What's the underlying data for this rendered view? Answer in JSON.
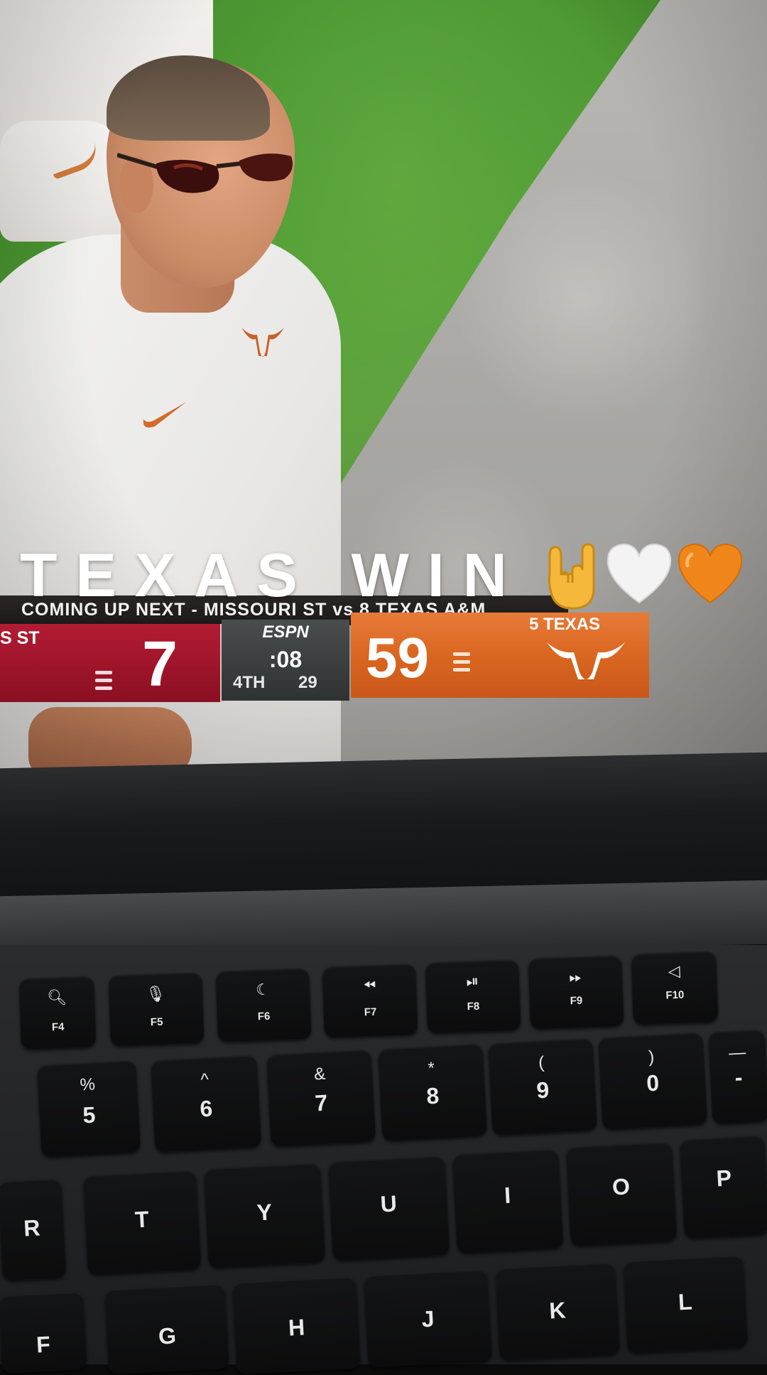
{
  "caption": {
    "text": "TEXAS WIN",
    "emojis": [
      "rock-on-hand",
      "white-heart",
      "orange-heart"
    ]
  },
  "scoreboard": {
    "ticker": "COMING UP NEXT - MISSOURI ST vs 8 TEXAS A&M",
    "network": "ESPN",
    "away": {
      "team": "S ST",
      "score": "7",
      "color": "#9c1428",
      "timeouts_remaining": 3
    },
    "home": {
      "team": "5 TEXAS",
      "score": "59",
      "color": "#d8651f",
      "timeouts_remaining": 3
    },
    "clock": ":08",
    "quarter": "4TH",
    "play_clock": "29"
  },
  "keyboard": {
    "function_row": [
      {
        "label": "F4",
        "icon": "search-icon"
      },
      {
        "label": "F5",
        "icon": "microphone-icon"
      },
      {
        "label": "F6",
        "icon": "moon-icon"
      },
      {
        "label": "F7",
        "icon": "rewind-icon"
      },
      {
        "label": "F8",
        "icon": "play-pause-icon"
      },
      {
        "label": "F9",
        "icon": "fast-forward-icon"
      },
      {
        "label": "F10",
        "icon": "mute-icon"
      }
    ],
    "number_row": [
      {
        "main": "5",
        "top": "%"
      },
      {
        "main": "6",
        "top": "^"
      },
      {
        "main": "7",
        "top": "&"
      },
      {
        "main": "8",
        "top": "*"
      },
      {
        "main": "9",
        "top": "("
      },
      {
        "main": "0",
        "top": ")"
      },
      {
        "main": "-",
        "top": "—"
      }
    ],
    "letter_row_1": [
      "R",
      "T",
      "Y",
      "U",
      "I",
      "O",
      "P"
    ],
    "letter_row_2": [
      "F",
      "G",
      "H",
      "J",
      "K",
      "L"
    ]
  }
}
